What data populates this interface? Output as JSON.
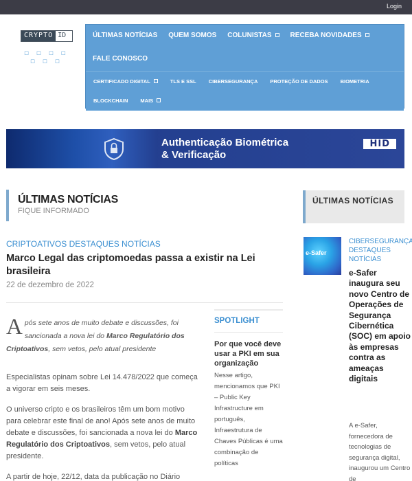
{
  "topbar": {
    "login_label": "Login"
  },
  "logo": {
    "left": "CRYPTO",
    "right": "ID",
    "tagline_squares": "□ □ □ □ □ □ □"
  },
  "nav": {
    "main": [
      {
        "label": "ÚLTIMAS NOTÍCIAS",
        "dropdown": false
      },
      {
        "label": "QUEM SOMOS",
        "dropdown": false
      },
      {
        "label": "COLUNISTAS",
        "dropdown": true
      },
      {
        "label": "RECEBA NOVIDADES",
        "dropdown": true
      },
      {
        "label": "FALE CONOSCO",
        "dropdown": false
      }
    ],
    "sub": [
      {
        "label": "CERTIFICADO DIGITAL",
        "dropdown": true
      },
      {
        "label": "TLS E SSL",
        "dropdown": false
      },
      {
        "label": "CIBERSEGURANÇA",
        "dropdown": false
      },
      {
        "label": "PROTEÇÃO DE DADOS",
        "dropdown": false
      },
      {
        "label": "BIOMETRIA",
        "dropdown": false
      },
      {
        "label": "BLOCKCHAIN",
        "dropdown": false
      },
      {
        "label": "MAIS",
        "dropdown": true
      }
    ]
  },
  "banner": {
    "line1": "Authenticação Biométrica",
    "line2": "& Verificação",
    "brand": "HID"
  },
  "section": {
    "title": "ÚLTIMAS NOTÍCIAS",
    "subtitle": "FIQUE INFORMADO"
  },
  "article": {
    "categories": "CRIPTOATIVOS DESTAQUES NOTÍCIAS",
    "title": "Marco Legal das criptomoedas passa a existir na Lei brasileira",
    "date": "22 de dezembro de 2022",
    "lead_dropcap": "A",
    "lead_text_1": "pós sete anos de muito debate e discussões, foi sancionada a nova lei do ",
    "lead_bold": "Marco Regulatório dos Criptoativos",
    "lead_text_2": ", sem vetos, pelo atual presidente",
    "p1": "Especialistas opinam sobre  Lei 14.478/2022 que começa a vigorar em seis meses.",
    "p2_text": "O universo cripto e os brasileiros têm um bom motivo para celebrar este final de ano! Após sete anos de muito debate e discussões, foi sancionada a nova lei do ",
    "p2_bold": "Marco Regulatório dos Criptoativos",
    "p2_end": ", sem vetos, pelo atual presidente.",
    "p3": "A partir de hoje, 22/12, data da publicação no Diário"
  },
  "spotlight": {
    "title": "SPOTLIGHT",
    "headline": "Por que você deve usar a PKI em sua organização",
    "body": "Nesse artigo, mencionamos que PKI – Public Key Infrastructure em português, Infraestrutura de Chaves Públicas é uma combinação de políticas"
  },
  "sidebar": {
    "title": "ÚLTIMAS NOTÍCIAS",
    "thumb_text": "e-Safer",
    "categories": "CIBERSEGURANÇA DESTAQUES NOTÍCIAS",
    "article_title": "e-Safer inaugura seu novo Centro de Operações de Segurança Cibernética (SOC) em apoio às empresas contra as ameaças digitais",
    "excerpt": "A e-Safer, fornecedora de tecnologias de segurança digital, inaugurou um Centro de"
  }
}
